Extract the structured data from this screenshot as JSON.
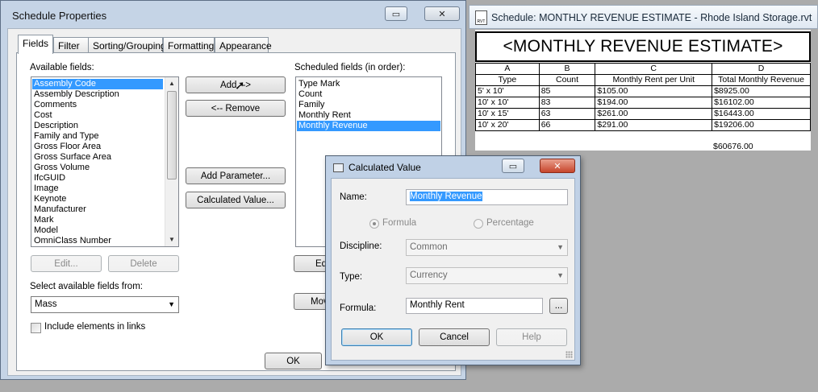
{
  "schedule_properties": {
    "title": "Schedule Properties",
    "tabs": [
      "Fields",
      "Filter",
      "Sorting/Grouping",
      "Formatting",
      "Appearance"
    ],
    "available_fields_label": "Available fields:",
    "available_fields": [
      "Assembly Code",
      "Assembly Description",
      "Comments",
      "Cost",
      "Description",
      "Family and Type",
      "Gross Floor Area",
      "Gross Surface Area",
      "Gross Volume",
      "IfcGUID",
      "Image",
      "Keynote",
      "Manufacturer",
      "Mark",
      "Model",
      "OmniClass Number"
    ],
    "buttons": {
      "add": "Add -->",
      "remove": "<-- Remove",
      "add_parameter": "Add Parameter...",
      "calculated_value": "Calculated Value...",
      "edit": "Edit...",
      "delete": "Delete",
      "edit_right": "Ed",
      "move": "Mov",
      "ok": "OK"
    },
    "scheduled_fields_label": "Scheduled fields (in order):",
    "scheduled_fields": [
      "Type Mark",
      "Count",
      "Family",
      "Monthly Rent",
      "Monthly Revenue"
    ],
    "select_from_label": "Select available fields from:",
    "select_from_value": "Mass",
    "include_links_label": "Include elements in links"
  },
  "schedule_view": {
    "title": "Schedule: MONTHLY REVENUE ESTIMATE - Rhode Island Storage.rvt",
    "icon_text": "RVT",
    "heading": "<MONTHLY REVENUE ESTIMATE>",
    "column_letters": [
      "A",
      "B",
      "C",
      "D"
    ],
    "column_headers": [
      "Type",
      "Count",
      "Monthly Rent per Unit",
      "Total Monthly Revenue"
    ],
    "rows": [
      [
        "5' x 10'",
        "85",
        "$105.00",
        "$8925.00"
      ],
      [
        "10' x 10'",
        "83",
        "$194.00",
        "$16102.00"
      ],
      [
        "10' x 15'",
        "63",
        "$261.00",
        "$16443.00"
      ],
      [
        "10' x 20'",
        "66",
        "$291.00",
        "$19206.00"
      ]
    ],
    "grand_total": "$60676.00"
  },
  "calculated_value": {
    "title": "Calculated Value",
    "name_label": "Name:",
    "name_value": "Monthly Revenue",
    "radio_formula": "Formula",
    "radio_percentage": "Percentage",
    "discipline_label": "Discipline:",
    "discipline_value": "Common",
    "type_label": "Type:",
    "type_value": "Currency",
    "formula_label": "Formula:",
    "formula_value": "Monthly Rent",
    "browse_label": "...",
    "ok": "OK",
    "cancel": "Cancel",
    "help": "Help"
  }
}
